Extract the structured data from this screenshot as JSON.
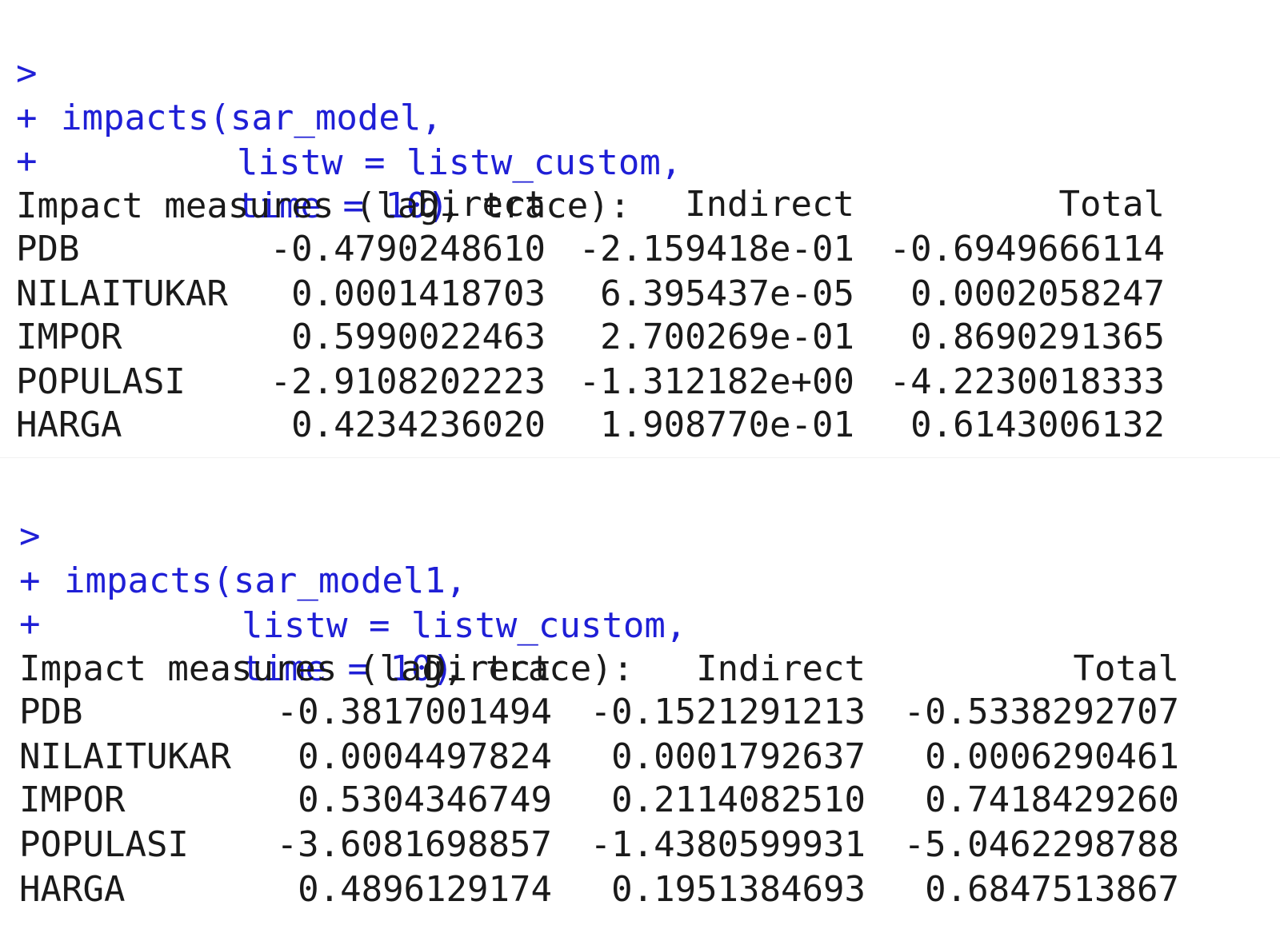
{
  "blocks": [
    {
      "command_lines": [
        {
          "prompt": ">",
          "text": "impacts(sar_model,"
        },
        {
          "prompt": "+",
          "text": "listw = listw_custom,"
        },
        {
          "prompt": "+",
          "text": "time = 10)"
        }
      ],
      "heading": "Impact measures (lag, trace):",
      "columns": [
        "Direct",
        "Indirect",
        "Total"
      ],
      "rows": [
        {
          "name": "PDB",
          "direct": "-0.4790248610",
          "indirect": "-2.159418e-01",
          "total": "-0.6949666114"
        },
        {
          "name": "NILAITUKAR",
          "direct": "0.0001418703",
          "indirect": "6.395437e-05",
          "total": "0.0002058247"
        },
        {
          "name": "IMPOR",
          "direct": "0.5990022463",
          "indirect": "2.700269e-01",
          "total": "0.8690291365"
        },
        {
          "name": "POPULASI",
          "direct": "-2.9108202223",
          "indirect": "-1.312182e+00",
          "total": "-4.2230018333"
        },
        {
          "name": "HARGA",
          "direct": "0.4234236020",
          "indirect": "1.908770e-01",
          "total": "0.6143006132"
        }
      ]
    },
    {
      "command_lines": [
        {
          "prompt": ">",
          "text": "impacts(sar_model1,"
        },
        {
          "prompt": "+",
          "text": "listw = listw_custom,"
        },
        {
          "prompt": "+",
          "text": "time = 10)"
        }
      ],
      "heading": "Impact measures (lag, trace):",
      "columns": [
        "Direct",
        "Indirect",
        "Total"
      ],
      "rows": [
        {
          "name": "PDB",
          "direct": "-0.3817001494",
          "indirect": "-0.1521291213",
          "total": "-0.5338292707"
        },
        {
          "name": "NILAITUKAR",
          "direct": "0.0004497824",
          "indirect": "0.0001792637",
          "total": "0.0006290461"
        },
        {
          "name": "IMPOR",
          "direct": "0.5304346749",
          "indirect": "0.2114082510",
          "total": "0.7418429260"
        },
        {
          "name": "POPULASI",
          "direct": "-3.6081698857",
          "indirect": "-1.4380599931",
          "total": "-5.0462298788"
        },
        {
          "name": "HARGA",
          "direct": "0.4896129174",
          "indirect": "0.1951384693",
          "total": "0.6847513867"
        }
      ]
    }
  ],
  "colors": {
    "input_text": "#1f1fd6",
    "output_text": "#1a1a1a",
    "background": "#ffffff"
  }
}
